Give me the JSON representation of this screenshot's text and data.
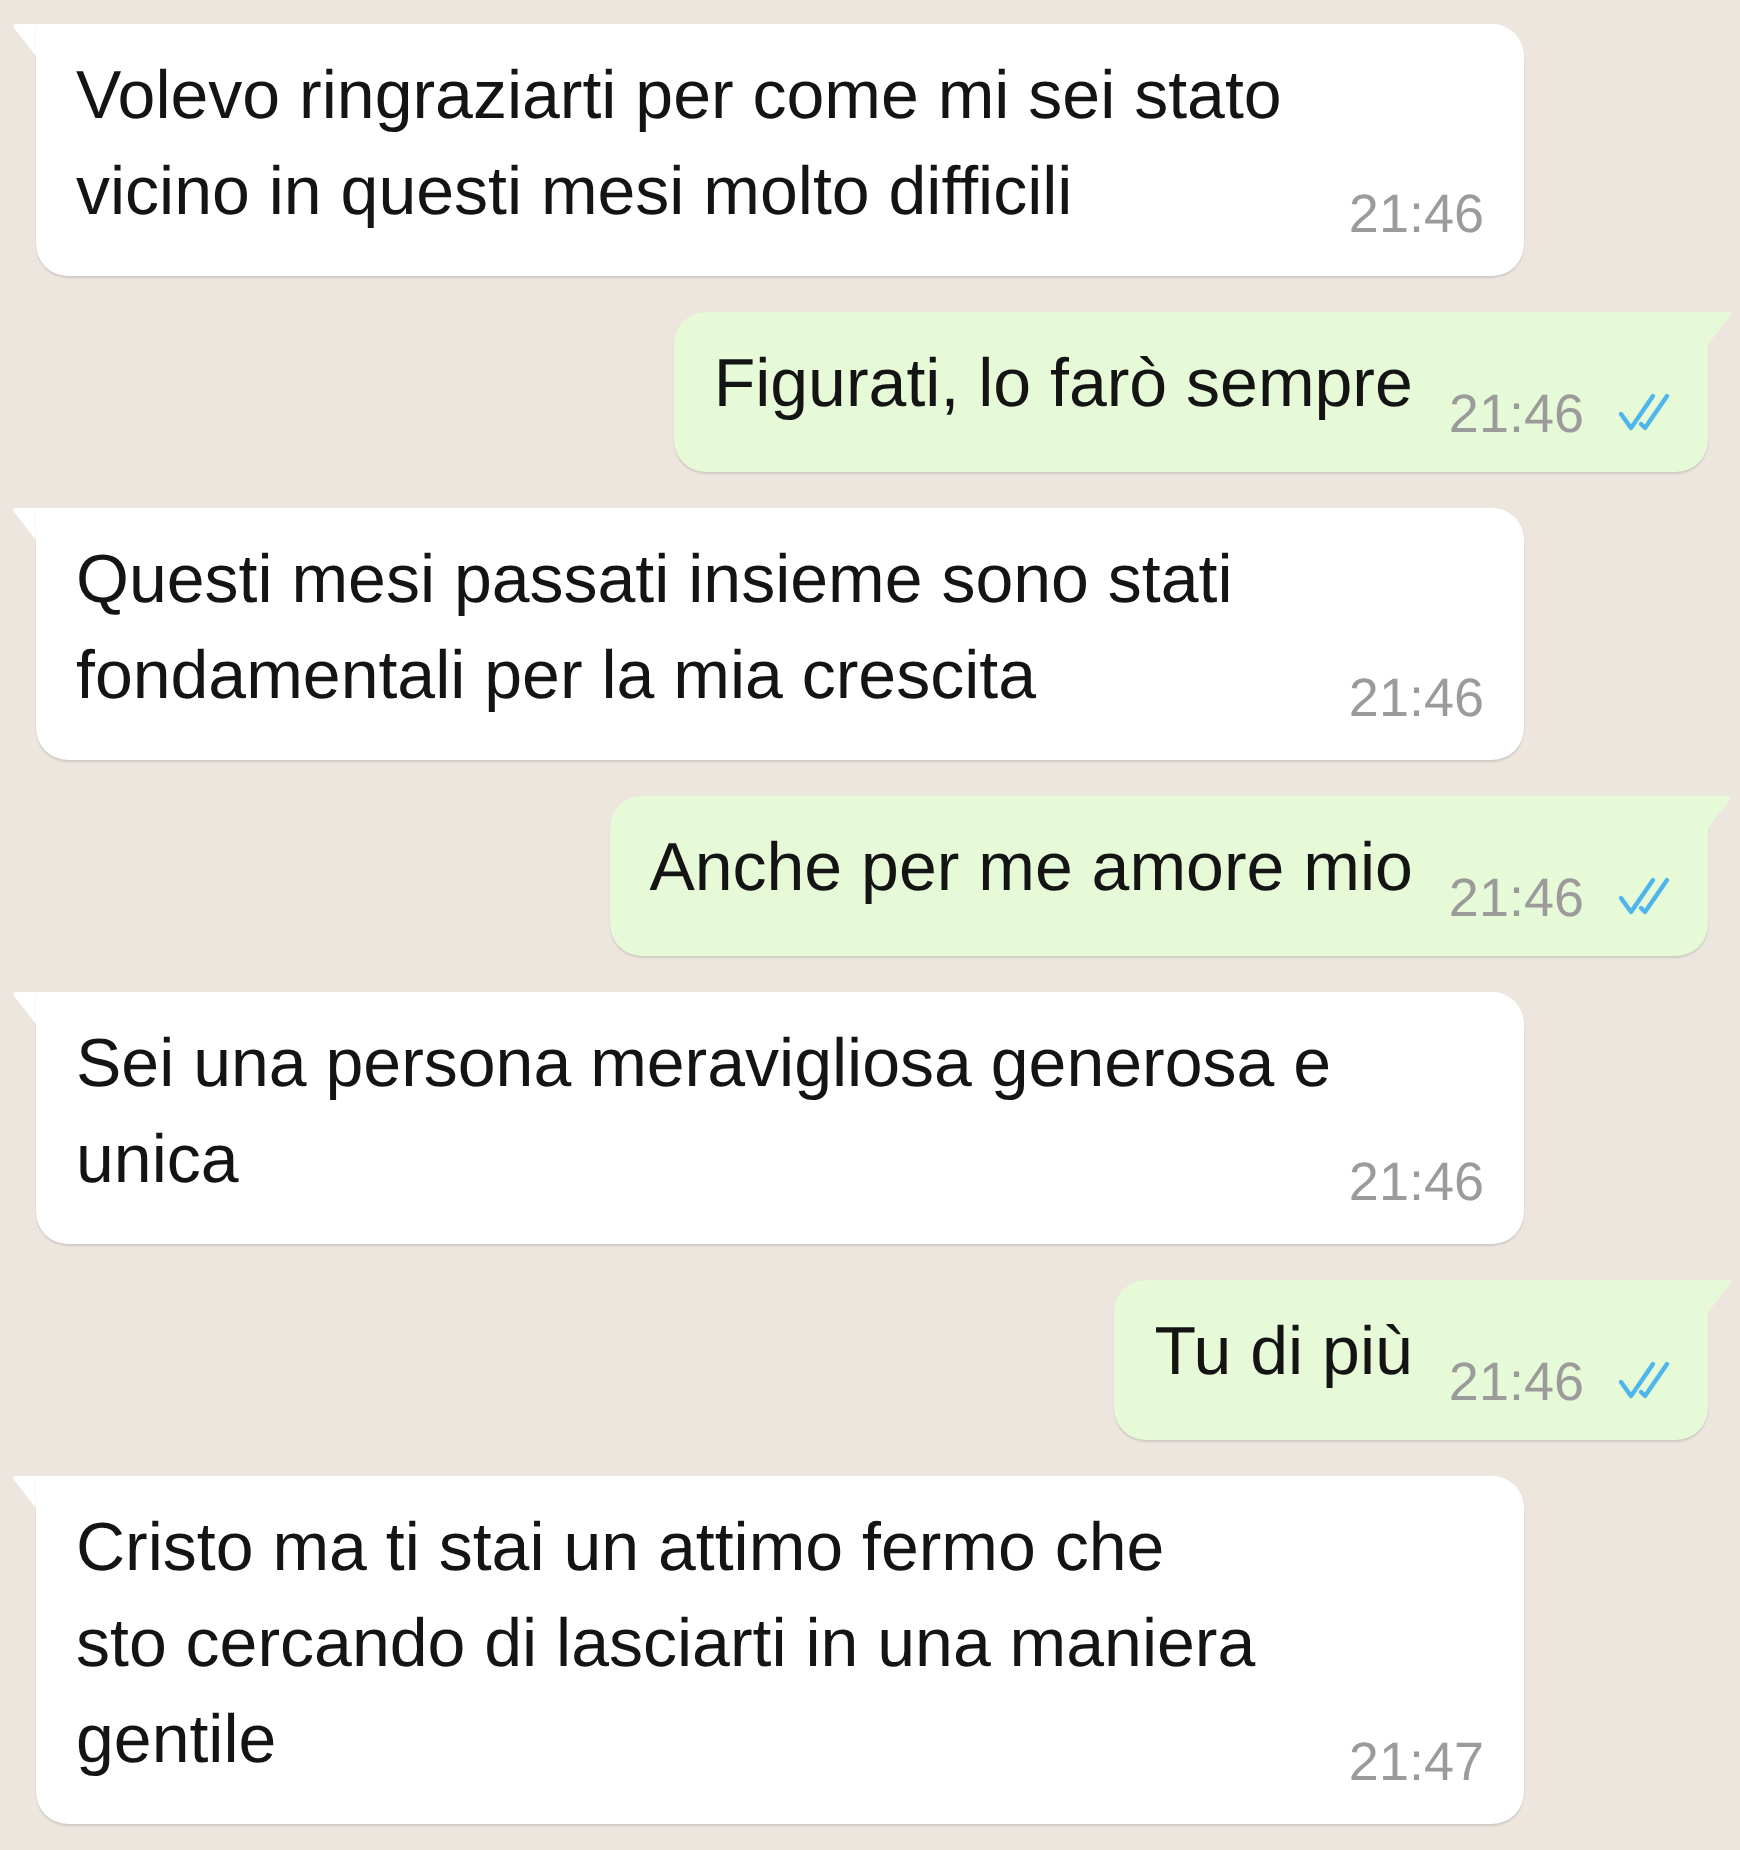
{
  "messages": [
    {
      "kind": "incoming",
      "text": "Volevo ringraziarti per come mi sei stato\nvicino in questi mesi molto difficili",
      "time": "21:46"
    },
    {
      "kind": "outgoing",
      "text": "Figurati, lo farò sempre",
      "time": "21:46",
      "read": true
    },
    {
      "kind": "incoming",
      "text": "Questi mesi passati insieme sono stati\nfondamentali per la mia crescita",
      "time": "21:46"
    },
    {
      "kind": "outgoing",
      "text": "Anche per me amore mio",
      "time": "21:46",
      "read": true
    },
    {
      "kind": "incoming",
      "text": "Sei una persona meravigliosa generosa e\nunica",
      "time": "21:46"
    },
    {
      "kind": "outgoing",
      "text": "Tu di più",
      "time": "21:46",
      "read": true
    },
    {
      "kind": "incoming",
      "text": "Cristo ma ti stai un attimo fermo che\nsto cercando di lasciarti in una maniera\ngentile",
      "time": "21:47"
    }
  ]
}
